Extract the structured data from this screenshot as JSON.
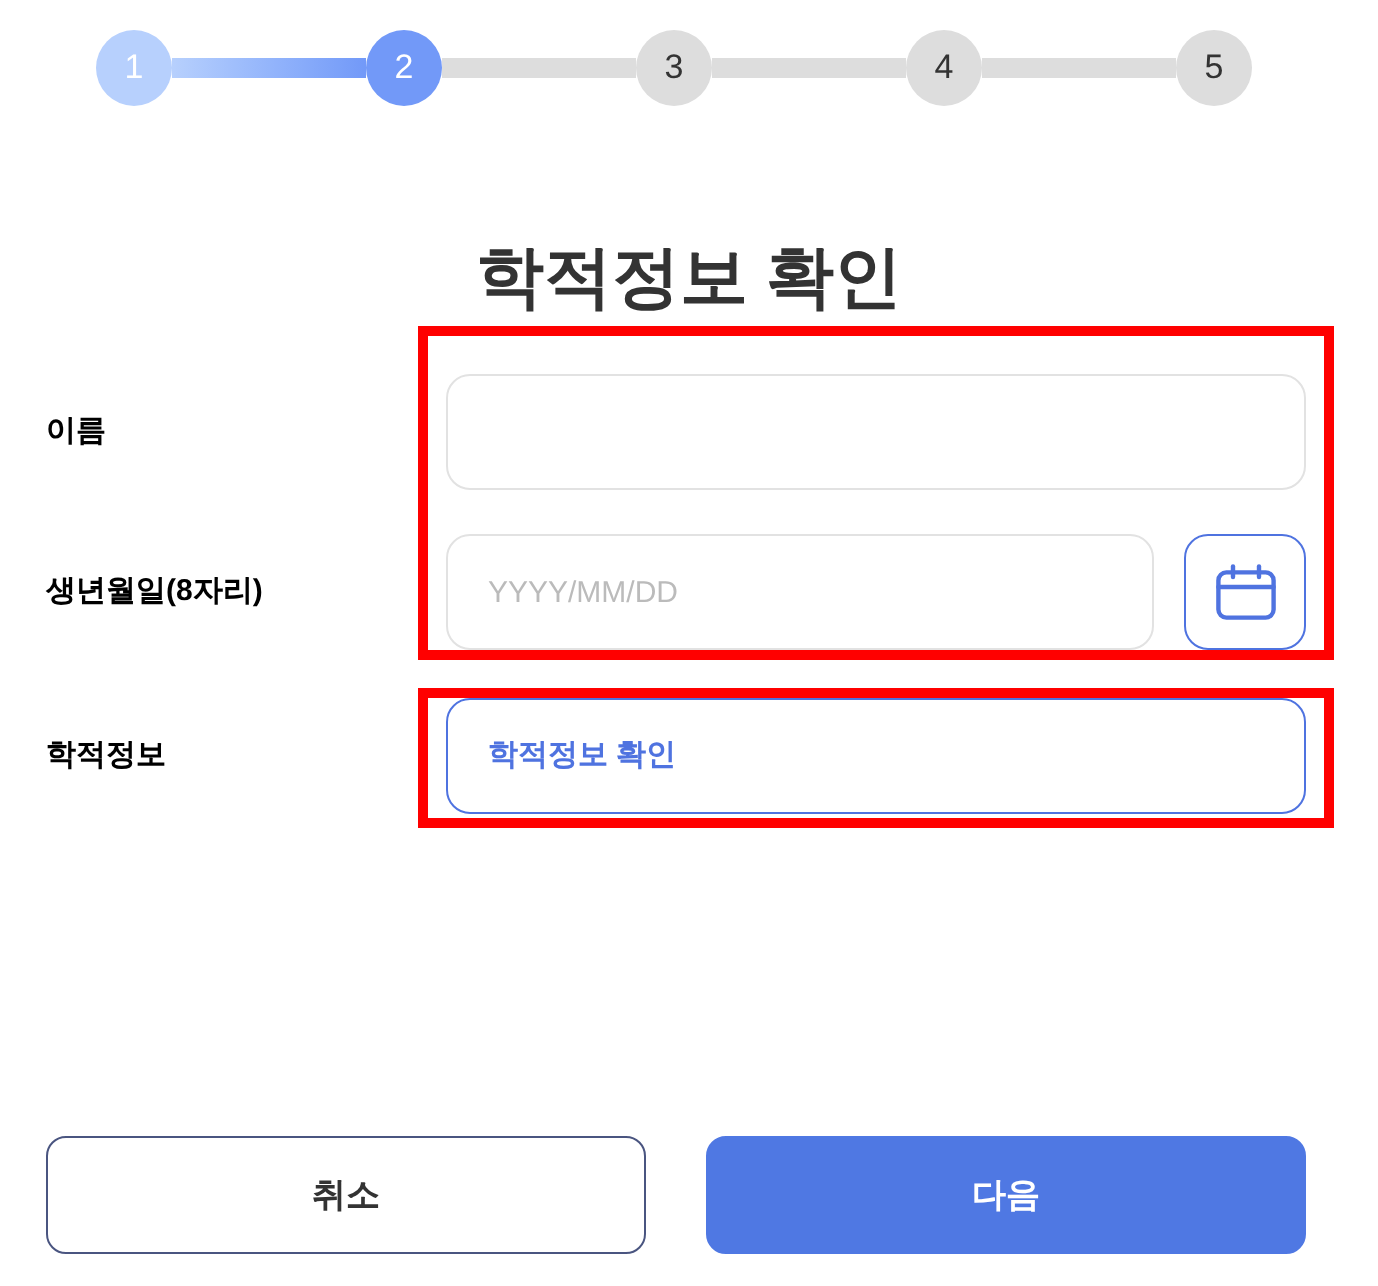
{
  "stepper": {
    "steps": [
      {
        "label": "1",
        "completed": true,
        "active": false
      },
      {
        "label": "2",
        "completed": false,
        "active": true
      },
      {
        "label": "3",
        "completed": false,
        "active": false
      },
      {
        "label": "4",
        "completed": false,
        "active": false
      },
      {
        "label": "5",
        "completed": false,
        "active": false
      }
    ]
  },
  "title": "학적정보 확인",
  "form": {
    "groups": [
      {
        "highlighted": true,
        "rows": [
          {
            "kind": "text",
            "label": "이름"
          },
          {
            "kind": "date",
            "label": "생년월일(8자리)",
            "placeholder": "YYYY/MM/DD"
          }
        ]
      },
      {
        "highlighted": true,
        "rows": [
          {
            "kind": "action",
            "label": "학적정보",
            "button": "학적정보 확인"
          }
        ]
      }
    ]
  },
  "buttons": [
    {
      "kind": "secondary",
      "label": "취소"
    },
    {
      "kind": "primary",
      "label": "다음"
    }
  ]
}
